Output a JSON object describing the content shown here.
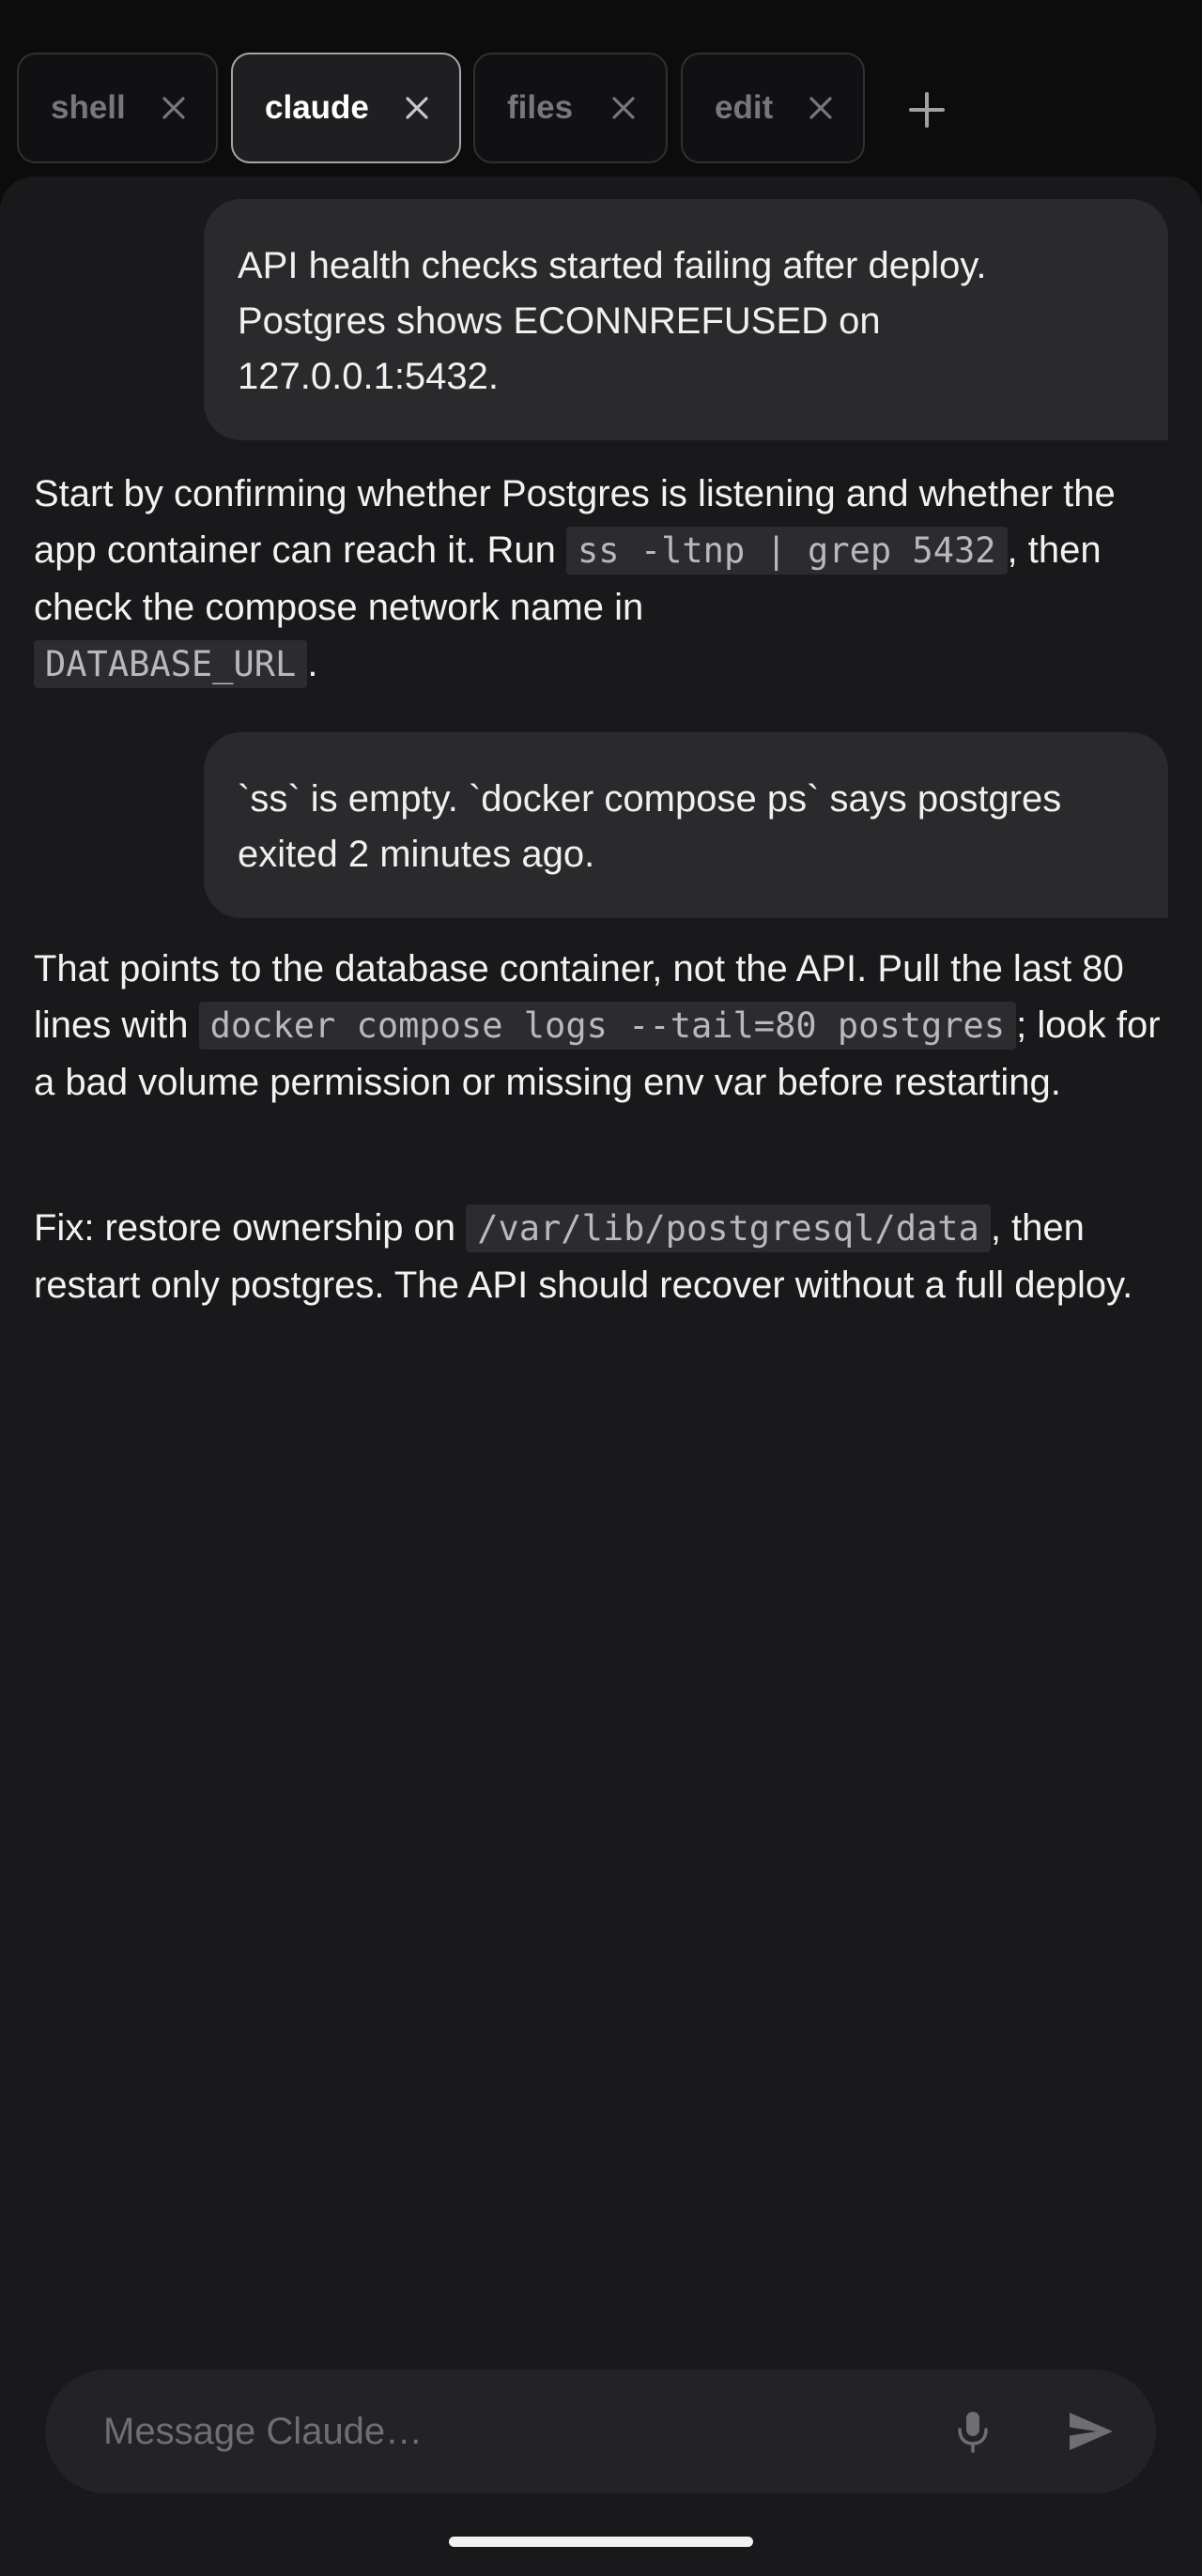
{
  "tabs": [
    {
      "label": "shell",
      "active": false
    },
    {
      "label": "claude",
      "active": true
    },
    {
      "label": "files",
      "active": false
    },
    {
      "label": "edit",
      "active": false
    }
  ],
  "icons": {
    "tab_close": "close-icon",
    "tab_add": "plus-icon",
    "mic": "microphone-icon",
    "send": "send-icon"
  },
  "conversation": {
    "user_1": "API health checks started failing after deploy. Postgres shows ECONNREFUSED on 127.0.0.1:5432.",
    "assistant_1": {
      "t1": "Start by confirming whether Postgres is listening and whether the app container can reach it. Run ",
      "c1": "ss -ltnp | grep 5432",
      "t2": ", then check the compose network name in ",
      "c2": "DATABASE_URL",
      "t3": "."
    },
    "user_2": "`ss` is empty. `docker compose ps` says postgres exited 2 minutes ago.",
    "assistant_2": {
      "t1": "That points to the database container, not the API. Pull the last 80 lines with ",
      "c1": "docker compose logs --tail=80 postgres",
      "t2": "; look for a bad volume permission or missing env var before restarting."
    },
    "assistant_3": {
      "t1": "Fix: restore ownership on ",
      "c1": "/var/lib/postgresql/data",
      "t2": ", then restart only postgres. The API should recover without a full deploy."
    }
  },
  "composer": {
    "placeholder": "Message Claude…",
    "value": ""
  },
  "colors": {
    "background": "#0c0c0d",
    "panel": "#19191b",
    "user_bubble": "#2a2a2d",
    "code_background": "#2c2c2f",
    "active_tab_border": "#a6a6aa"
  }
}
